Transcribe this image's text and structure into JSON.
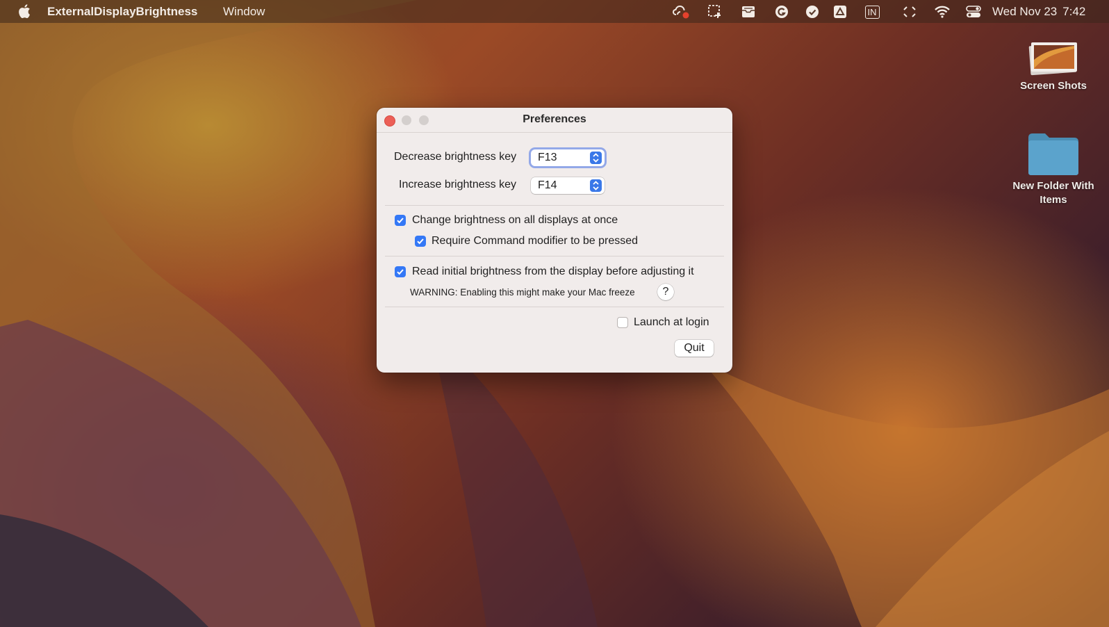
{
  "menubar": {
    "app_name": "ExternalDisplayBrightness",
    "menu_window": "Window",
    "status_keyboard": "IN",
    "clock_date": "Wed Nov 23",
    "clock_time": "7:42"
  },
  "desktop": {
    "screenshots_label": "Screen Shots",
    "folder_label_line1": "New Folder With",
    "folder_label_line2": "Items"
  },
  "window": {
    "title": "Preferences",
    "decrease_label": "Decrease brightness key",
    "decrease_value": "F13",
    "increase_label": "Increase brightness key",
    "increase_value": "F14",
    "all_displays_label": "Change brightness on all displays at once",
    "all_displays_checked": true,
    "command_modifier_label": "Require Command modifier to be pressed",
    "command_modifier_checked": true,
    "read_initial_label": "Read initial brightness from the display before adjusting it",
    "read_initial_checked": true,
    "warning_text": "WARNING: Enabling this might make your Mac freeze",
    "help_label": "?",
    "launch_login_label": "Launch at login",
    "launch_login_checked": false,
    "quit_label": "Quit"
  },
  "colors": {
    "accent": "#3478f6",
    "close_button": "#ec5f57"
  }
}
